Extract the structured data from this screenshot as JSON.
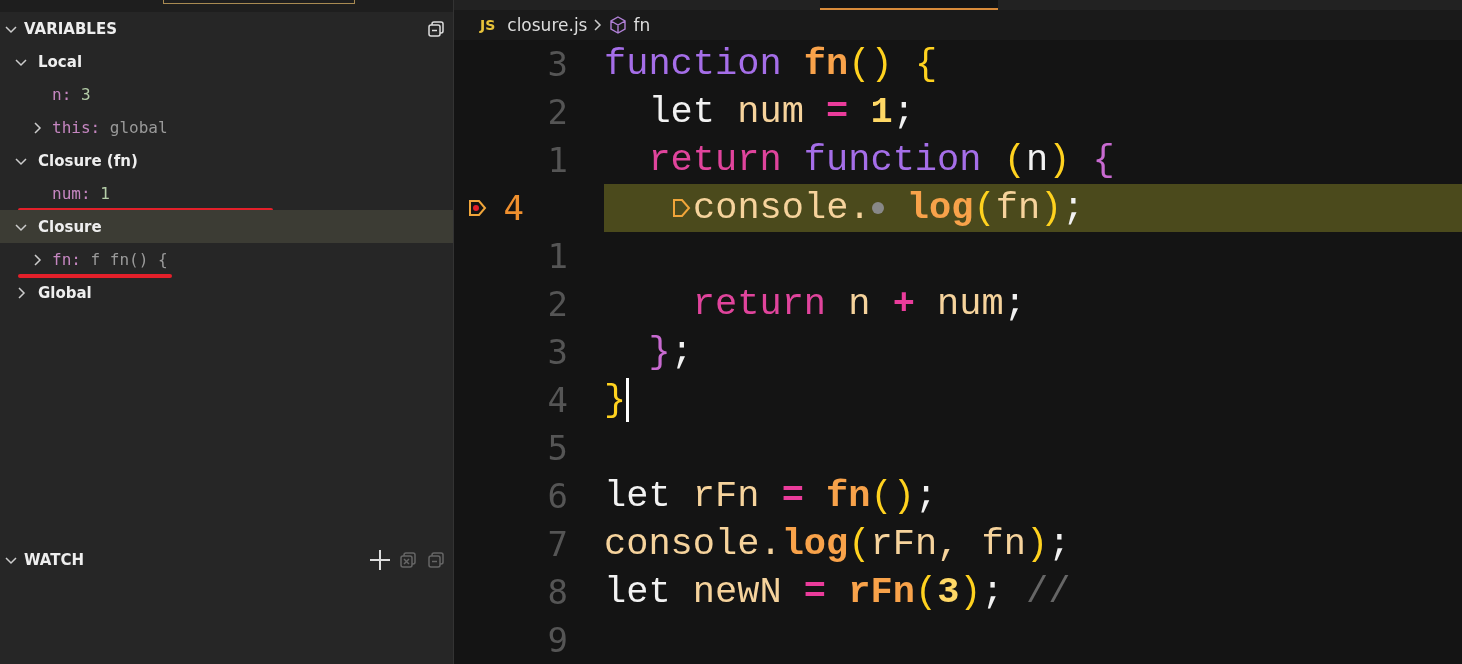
{
  "variables": {
    "title": "VARIABLES",
    "expanded": true,
    "items": [
      {
        "kind": "scope",
        "label": "Local",
        "expanded": true,
        "selected": false,
        "children": [
          {
            "kind": "number",
            "name": "n:",
            "value": "3",
            "selected": false,
            "annotated": false
          },
          {
            "kind": "object",
            "name": "this:",
            "value": "global",
            "expanded": false,
            "selected": false,
            "annotated": false
          }
        ]
      },
      {
        "kind": "scope",
        "label": "Closure (fn)",
        "expanded": true,
        "selected": false,
        "children": [
          {
            "kind": "number",
            "name": "num:",
            "value": "1",
            "selected": false,
            "annotated": true
          }
        ]
      },
      {
        "kind": "scope",
        "label": "Closure",
        "expanded": true,
        "selected": true,
        "children": [
          {
            "kind": "object",
            "name": "fn:",
            "value": "f fn() {",
            "expanded": false,
            "selected": false,
            "annotated": true
          }
        ]
      },
      {
        "kind": "scope",
        "label": "Global",
        "expanded": false,
        "selected": false
      }
    ]
  },
  "watch": {
    "title": "WATCH",
    "expanded": true
  },
  "breadcrumb": {
    "file_badge": "JS",
    "file": "closure.js",
    "symbol": "fn"
  },
  "lines": [
    {
      "number": "3",
      "current": false,
      "breakpoint": false,
      "cursor": false,
      "tokens": [
        {
          "kind": "kw",
          "text": "function "
        },
        {
          "kind": "fn",
          "text": "fn"
        },
        {
          "kind": "paren",
          "text": "() {"
        }
      ]
    },
    {
      "number": "2",
      "current": false,
      "breakpoint": false,
      "cursor": false,
      "tokens": [
        {
          "kind": "plain",
          "text": "  let "
        },
        {
          "kind": "var",
          "text": "num "
        },
        {
          "kind": "op",
          "text": "= "
        },
        {
          "kind": "num",
          "text": "1"
        },
        {
          "kind": "plain",
          "text": ";"
        }
      ]
    },
    {
      "number": "1",
      "current": false,
      "breakpoint": false,
      "cursor": false,
      "tokens": [
        {
          "kind": "ret",
          "text": "  return "
        },
        {
          "kind": "kw",
          "text": "function "
        },
        {
          "kind": "paren",
          "text": "("
        },
        {
          "kind": "plain",
          "text": "n"
        },
        {
          "kind": "paren",
          "text": ") "
        },
        {
          "kind": "brace",
          "text": "{"
        }
      ]
    },
    {
      "number": "4",
      "current": true,
      "breakpoint": true,
      "cursor": false,
      "tokens": [
        {
          "kind": "marker"
        },
        {
          "kind": "var",
          "text": "console."
        },
        {
          "kind": "dot"
        },
        {
          "kind": "fn",
          "text": " log"
        },
        {
          "kind": "paren",
          "text": "("
        },
        {
          "kind": "var",
          "text": "fn"
        },
        {
          "kind": "paren",
          "text": ")"
        },
        {
          "kind": "plain",
          "text": ";"
        }
      ]
    },
    {
      "number": "1",
      "current": false,
      "breakpoint": false,
      "cursor": false
    },
    {
      "number": "2",
      "current": false,
      "breakpoint": false,
      "cursor": false,
      "tokens": [
        {
          "kind": "ret",
          "text": "    return "
        },
        {
          "kind": "var",
          "text": "n "
        },
        {
          "kind": "op",
          "text": "+ "
        },
        {
          "kind": "var",
          "text": "num"
        },
        {
          "kind": "plain",
          "text": ";"
        }
      ]
    },
    {
      "number": "3",
      "current": false,
      "breakpoint": false,
      "cursor": false,
      "tokens": [
        {
          "kind": "brace",
          "text": "  }"
        },
        {
          "kind": "plain",
          "text": ";"
        }
      ]
    },
    {
      "number": "4",
      "current": false,
      "breakpoint": false,
      "cursor": true,
      "tokens": [
        {
          "kind": "paren",
          "text": "}"
        }
      ]
    },
    {
      "number": "5",
      "current": false,
      "breakpoint": false,
      "cursor": false
    },
    {
      "number": "6",
      "current": false,
      "breakpoint": false,
      "cursor": false,
      "tokens": [
        {
          "kind": "plain",
          "text": "let "
        },
        {
          "kind": "var",
          "text": "rFn "
        },
        {
          "kind": "op",
          "text": "= "
        },
        {
          "kind": "fn",
          "text": "fn"
        },
        {
          "kind": "paren",
          "text": "()"
        },
        {
          "kind": "plain",
          "text": ";"
        }
      ]
    },
    {
      "number": "7",
      "current": false,
      "breakpoint": false,
      "cursor": false,
      "tokens": [
        {
          "kind": "var",
          "text": "console."
        },
        {
          "kind": "fn",
          "text": "log"
        },
        {
          "kind": "paren",
          "text": "("
        },
        {
          "kind": "var",
          "text": "rFn, fn"
        },
        {
          "kind": "paren",
          "text": ")"
        },
        {
          "kind": "plain",
          "text": ";"
        }
      ]
    },
    {
      "number": "8",
      "current": false,
      "breakpoint": false,
      "cursor": false,
      "tokens": [
        {
          "kind": "plain",
          "text": "let "
        },
        {
          "kind": "var",
          "text": "newN "
        },
        {
          "kind": "op",
          "text": "= "
        },
        {
          "kind": "fn",
          "text": "rFn"
        },
        {
          "kind": "paren",
          "text": "("
        },
        {
          "kind": "num",
          "text": "3"
        },
        {
          "kind": "paren",
          "text": ")"
        },
        {
          "kind": "plain",
          "text": "; "
        },
        {
          "kind": "comment",
          "text": "//"
        }
      ]
    },
    {
      "number": "9",
      "current": false,
      "breakpoint": false,
      "cursor": false
    }
  ]
}
